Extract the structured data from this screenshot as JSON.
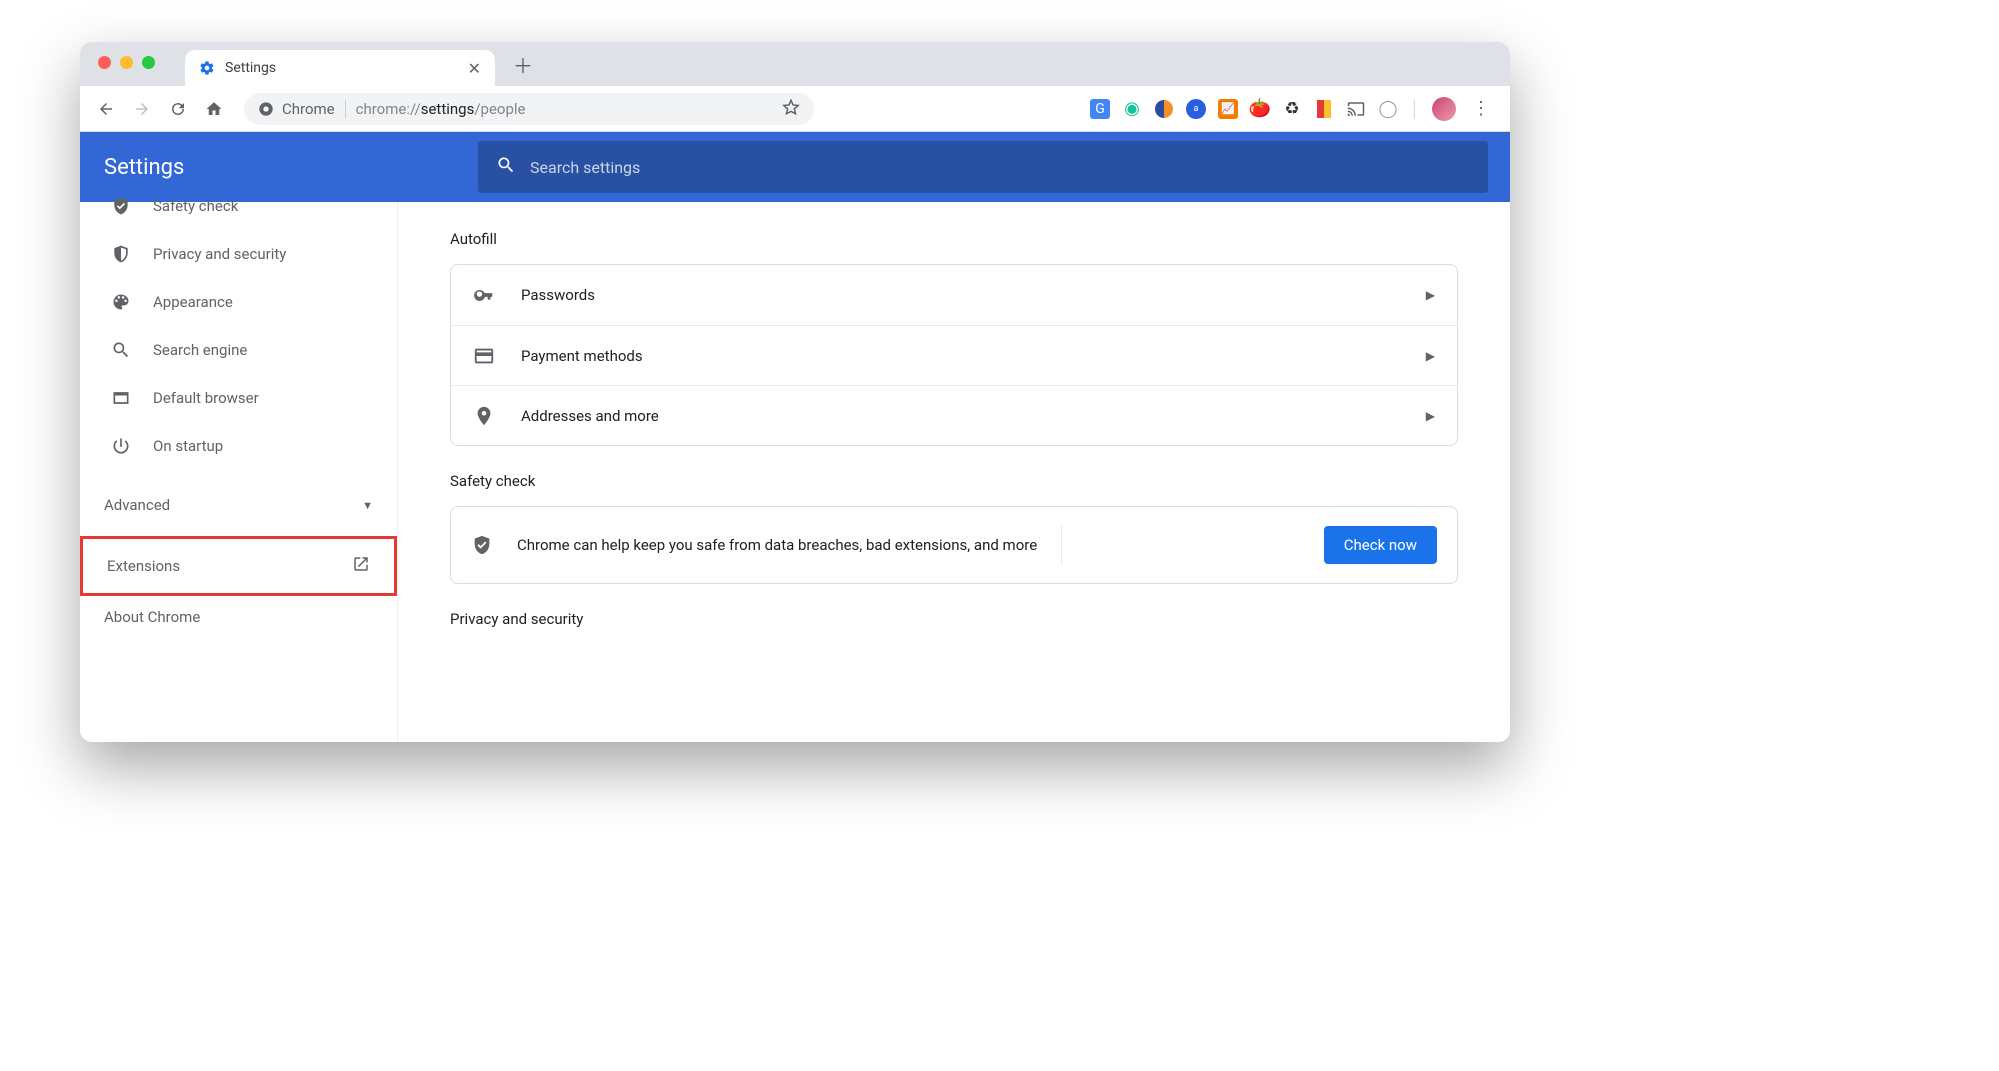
{
  "browser": {
    "tab_title": "Settings",
    "omnibox_app": "Chrome",
    "omnibox_prefix": "chrome://",
    "omnibox_bold": "settings",
    "omnibox_suffix": "/people"
  },
  "header": {
    "title": "Settings",
    "search_placeholder": "Search settings"
  },
  "sidebar": {
    "items": [
      {
        "label": "Safety check"
      },
      {
        "label": "Privacy and security"
      },
      {
        "label": "Appearance"
      },
      {
        "label": "Search engine"
      },
      {
        "label": "Default browser"
      },
      {
        "label": "On startup"
      }
    ],
    "advanced": "Advanced",
    "extensions": "Extensions",
    "about": "About Chrome"
  },
  "main": {
    "autofill_title": "Autofill",
    "autofill_rows": [
      {
        "label": "Passwords"
      },
      {
        "label": "Payment methods"
      },
      {
        "label": "Addresses and more"
      }
    ],
    "safety_title": "Safety check",
    "safety_text": "Chrome can help keep you safe from data breaches, bad extensions, and more",
    "check_now": "Check now",
    "privacy_cut": "Privacy and security"
  }
}
